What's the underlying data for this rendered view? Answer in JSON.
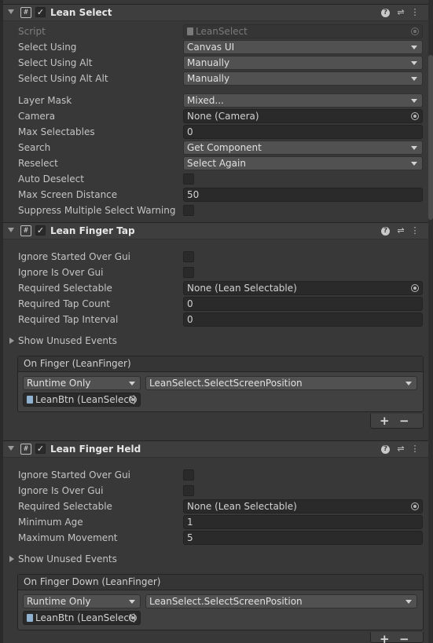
{
  "components": [
    {
      "title": "Lean Select",
      "script": {
        "label": "Script",
        "value": "LeanSelect"
      },
      "select_using": {
        "label": "Select Using",
        "value": "Canvas UI"
      },
      "select_using_alt": {
        "label": "Select Using Alt",
        "value": "Manually"
      },
      "select_using_alt_alt": {
        "label": "Select Using Alt Alt",
        "value": "Manually"
      },
      "layer_mask": {
        "label": "Layer Mask",
        "value": "Mixed..."
      },
      "camera": {
        "label": "Camera",
        "value": "None (Camera)"
      },
      "max_selectables": {
        "label": "Max Selectables",
        "value": "0"
      },
      "search": {
        "label": "Search",
        "value": "Get Component"
      },
      "reselect": {
        "label": "Reselect",
        "value": "Select Again"
      },
      "auto_deselect": {
        "label": "Auto Deselect",
        "checked": false
      },
      "max_screen_distance": {
        "label": "Max Screen Distance",
        "value": "50"
      },
      "suppress_warning": {
        "label": "Suppress Multiple Select Warning",
        "checked": false
      }
    },
    {
      "title": "Lean Finger Tap",
      "ignore_started_over_gui": {
        "label": "Ignore Started Over Gui",
        "checked": false
      },
      "ignore_is_over_gui": {
        "label": "Ignore Is Over Gui",
        "checked": false
      },
      "required_selectable": {
        "label": "Required Selectable",
        "value": "None (Lean Selectable)"
      },
      "required_tap_count": {
        "label": "Required Tap Count",
        "value": "0"
      },
      "required_tap_interval": {
        "label": "Required Tap Interval",
        "value": "0"
      },
      "show_unused_events": "Show Unused Events",
      "event": {
        "title": "On Finger (LeanFinger)",
        "runtime": "Runtime Only",
        "method": "LeanSelect.SelectScreenPosition",
        "target": "LeanBtn (LeanSelect)"
      },
      "plus": "+",
      "minus": "−"
    },
    {
      "title": "Lean Finger Held",
      "ignore_started_over_gui": {
        "label": "Ignore Started Over Gui",
        "checked": false
      },
      "ignore_is_over_gui": {
        "label": "Ignore Is Over Gui",
        "checked": false
      },
      "required_selectable": {
        "label": "Required Selectable",
        "value": "None (Lean Selectable)"
      },
      "minimum_age": {
        "label": "Minimum Age",
        "value": "1"
      },
      "maximum_movement": {
        "label": "Maximum Movement",
        "value": "5"
      },
      "show_unused_events": "Show Unused Events",
      "event": {
        "title": "On Finger Down (LeanFinger)",
        "runtime": "Runtime Only",
        "method": "LeanSelect.SelectScreenPosition",
        "target": "LeanBtn (LeanSelect)"
      },
      "plus": "+",
      "minus": "−"
    }
  ],
  "header_icons": {
    "help": "?",
    "presets": "⇌",
    "menu": "⋮",
    "script": "#",
    "check": "✓"
  }
}
